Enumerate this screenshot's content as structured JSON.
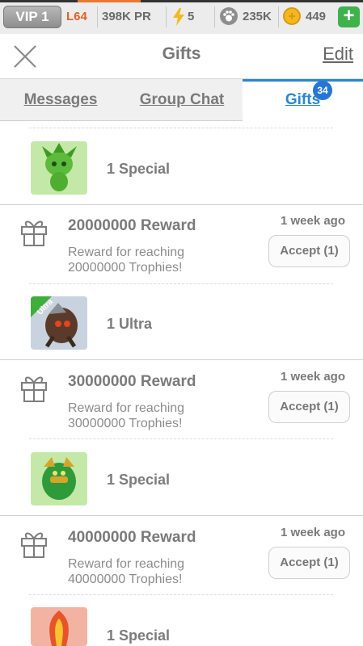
{
  "status_bar": {
    "vip": "VIP 1",
    "level": "L64",
    "pr": "398K PR",
    "energy": "5",
    "paw_count": "235K",
    "coins": "449",
    "plus": "+"
  },
  "header": {
    "title": "Gifts",
    "edit_label": "Edit"
  },
  "tabs": [
    {
      "label": "Messages"
    },
    {
      "label": "Group Chat"
    },
    {
      "label": "Gifts",
      "badge": "34",
      "active": true
    }
  ],
  "gifts": [
    {
      "item_label": "1 Special",
      "item_icon": "green-leaf-monster-icon"
    },
    {
      "title": "20000000 Reward",
      "desc_line1": "Reward for reaching",
      "desc_line2": "20000000 Trophies!",
      "time": "1 week ago",
      "accept_label": "Accept (1)",
      "item_label": "1 Ultra",
      "item_icon": "armored-spike-monster-icon",
      "item_ribbon": "Ultra"
    },
    {
      "title": "30000000 Reward",
      "desc_line1": "Reward for reaching",
      "desc_line2": "30000000 Trophies!",
      "time": "1 week ago",
      "accept_label": "Accept (1)",
      "item_label": "1 Special",
      "item_icon": "green-gold-monster-icon"
    },
    {
      "title": "40000000 Reward",
      "desc_line1": "Reward for reaching",
      "desc_line2": "40000000 Trophies!",
      "time": "1 week ago",
      "accept_label": "Accept (1)",
      "item_label": "1 Special",
      "item_icon": "fire-monster-icon"
    }
  ],
  "colors": {
    "accent": "#2a86d0",
    "level": "#e35f24",
    "plus": "#3fb24b",
    "coin": "#f2b820"
  }
}
